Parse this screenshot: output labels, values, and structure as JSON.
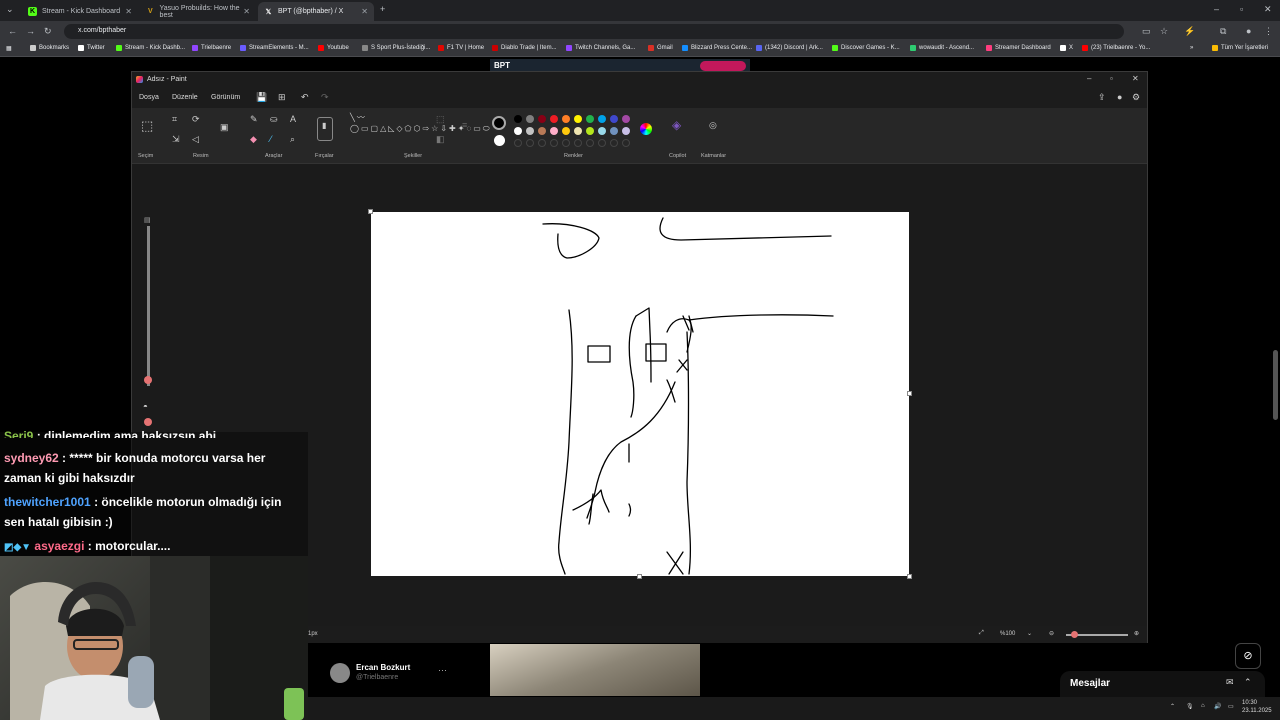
{
  "browser": {
    "tabs": [
      {
        "title": "Stream - Kick Dashboard",
        "icon": "kick-icon",
        "color": "#53fc18"
      },
      {
        "title": "Yasuo Probuilds: How the best",
        "icon": "v-icon",
        "color": "#d4a017"
      },
      {
        "title": "BPT (@bpthaber) / X",
        "icon": "x-icon",
        "color": "#ffffff"
      }
    ],
    "url": "x.com/bpthaber",
    "bookmarks": [
      "Bookmarks",
      "Twitter",
      "Stream - Kick Dashb...",
      "Trielbaenre",
      "StreamElements - M...",
      "Youtube",
      "S Sport Plus-İstediği...",
      "F1 TV | Home",
      "Diablo Trade | Item...",
      "Twitch Channels, Ga...",
      "Gmail",
      "Blizzard Press Cente...",
      "(1342) Discord | Ark...",
      "Discover Games - K...",
      "wowaudit - Ascend...",
      "Streamer Dashboard",
      "X",
      "(23) Trielbaenre - Yo..."
    ],
    "bookmarks_all": "Tüm Yer İşaretleri"
  },
  "x_page": {
    "header_name": "BPT",
    "tweet_author": "Ercan Bozkurt",
    "tweet_handle": "@Trielbaenre",
    "messages_label": "Mesajlar"
  },
  "paint": {
    "title": "Adsız - Paint",
    "menu": [
      "Dosya",
      "Düzenle",
      "Görünüm"
    ],
    "groups": [
      "Seçim",
      "Resim",
      "Araçlar",
      "Fırçalar",
      "Şekiller",
      "Renkler",
      "Copilot",
      "Katmanlar"
    ],
    "status_size": "1px",
    "zoom": "%100",
    "palette_row1": [
      "#000000",
      "#7f7f7f",
      "#880015",
      "#ed1c24",
      "#ff7f27",
      "#fff200",
      "#22b14c",
      "#00a2e8",
      "#3f48cc",
      "#a349a4"
    ],
    "palette_row2": [
      "#ffffff",
      "#c3c3c3",
      "#b97a57",
      "#ffaec9",
      "#ffc90e",
      "#efe4b0",
      "#b5e61d",
      "#99d9ea",
      "#7092be",
      "#c8bfe7"
    ]
  },
  "chat": [
    {
      "user": "Seri9",
      "text": ": dinlemedim ama haksızsın abi",
      "color": "#8bc34a"
    },
    {
      "user": "sydney62",
      "text": ": ***** bir konuda motorcu varsa her zaman ki gibi haksızdır",
      "color": "#ff9bb3"
    },
    {
      "user": "thewitcher1001",
      "text": ": öncelikle motorun olmadığı için sen hatalı gibisin :)",
      "color": "#4fa3ff"
    },
    {
      "user": "asyaezgi",
      "text": ": motorcular....",
      "color": "#ff6b8a"
    }
  ],
  "taskbar": {
    "time": "10:30",
    "date": "23.11.2025"
  }
}
